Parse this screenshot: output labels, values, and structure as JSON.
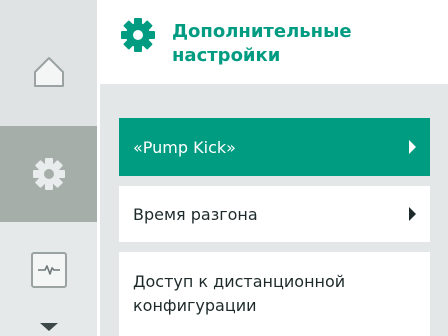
{
  "header": {
    "title": "Дополнительные настройки",
    "icon": "gear-icon"
  },
  "sidebar": {
    "items": [
      {
        "name": "home",
        "icon": "home-icon",
        "selected": false
      },
      {
        "name": "settings",
        "icon": "gear-icon",
        "selected": true
      },
      {
        "name": "diagnostics",
        "icon": "pulse-icon",
        "selected": false
      }
    ]
  },
  "menu": {
    "items": [
      {
        "label": "«Pump Kick»",
        "selected": true,
        "has_submenu": true
      },
      {
        "label": "Время разгона",
        "selected": false,
        "has_submenu": true
      },
      {
        "label": "Доступ к дистанционной конфигурации",
        "selected": false,
        "has_submenu": false
      }
    ]
  },
  "colors": {
    "accent": "#009c82",
    "sidebar_selected": "#a5aea9",
    "sidebar_bg": "#dfe3e3",
    "content_bg": "#e4e7e7"
  }
}
